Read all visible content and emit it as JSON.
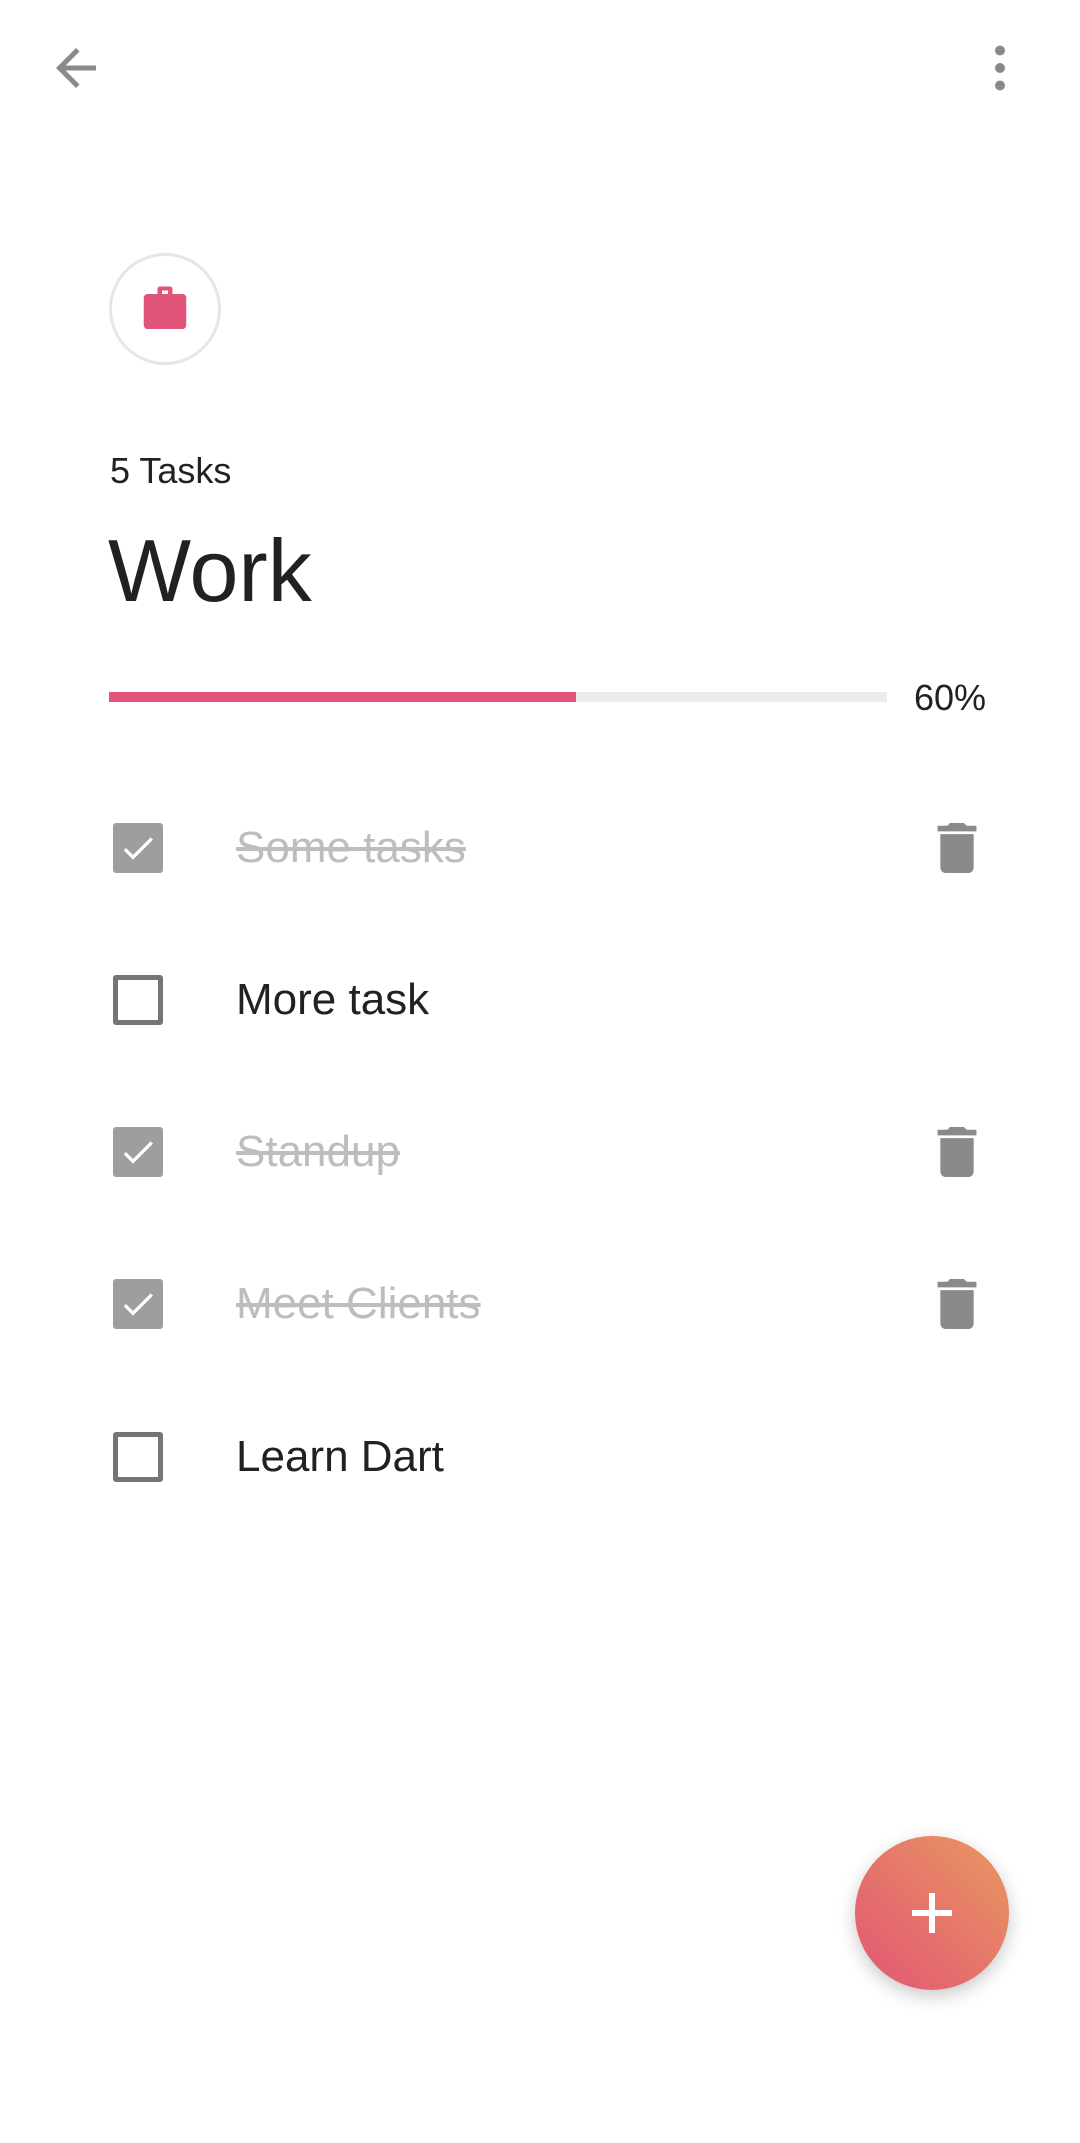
{
  "category": {
    "icon": "briefcase-icon",
    "task_count_label": "5 Tasks",
    "name": "Work",
    "progress_percent": 60,
    "progress_label": "60%"
  },
  "tasks": [
    {
      "label": "Some tasks",
      "done": true
    },
    {
      "label": "More task",
      "done": false
    },
    {
      "label": "Standup",
      "done": true
    },
    {
      "label": "Meet Clients",
      "done": true
    },
    {
      "label": "Learn Dart",
      "done": false
    }
  ],
  "colors": {
    "accent": "#e2557a",
    "fab_start": "#e25576",
    "fab_end": "#e8985f"
  }
}
